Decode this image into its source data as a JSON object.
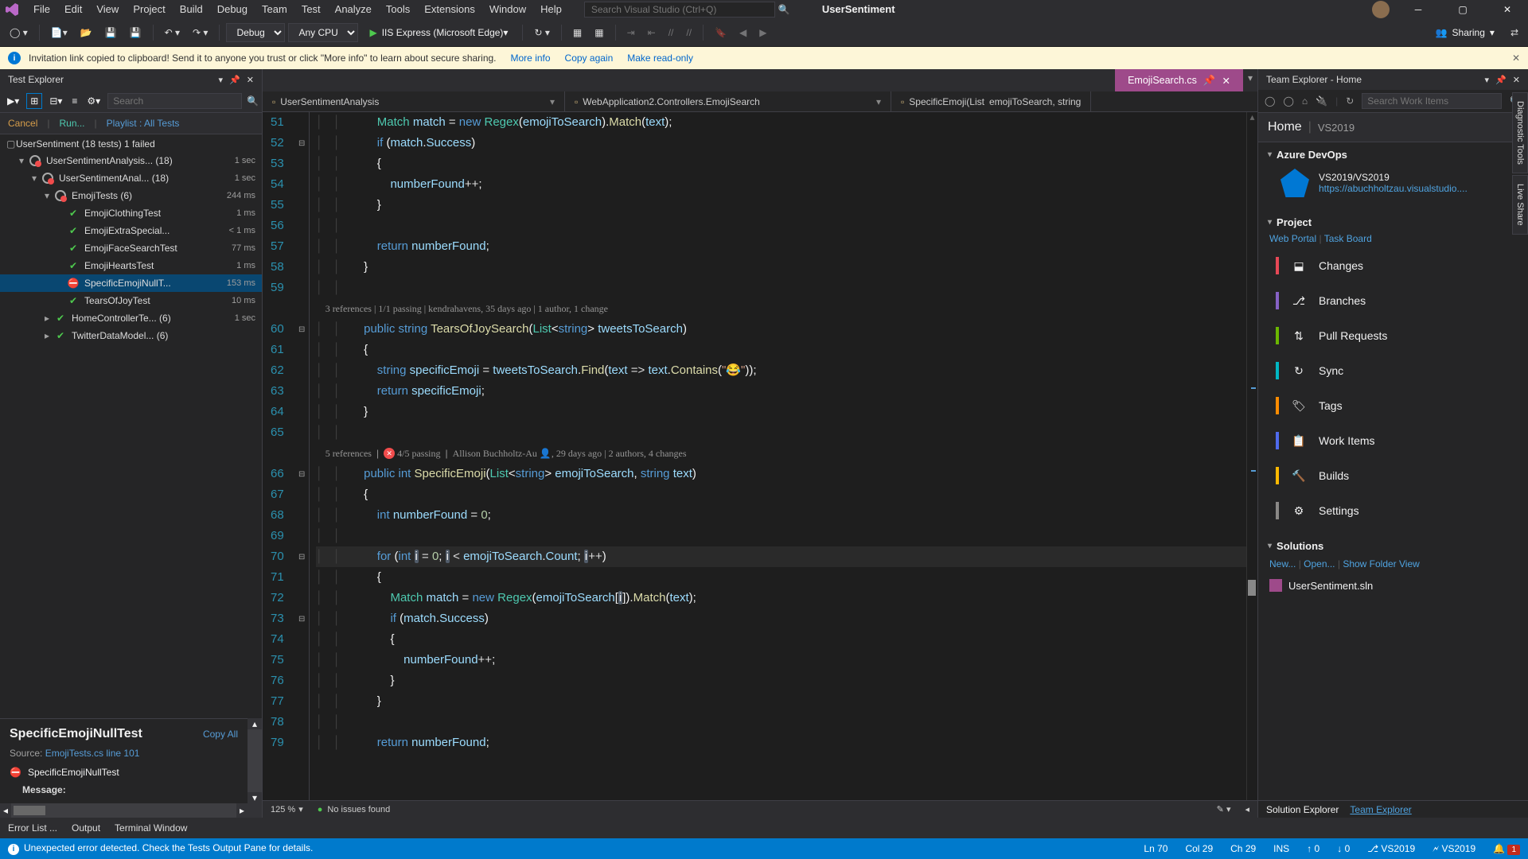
{
  "titlebar": {
    "menus": [
      "File",
      "Edit",
      "View",
      "Project",
      "Build",
      "Debug",
      "Team",
      "Test",
      "Analyze",
      "Tools",
      "Extensions",
      "Window",
      "Help"
    ],
    "search_placeholder": "Search Visual Studio (Ctrl+Q)",
    "app_name": "UserSentiment"
  },
  "toolbar": {
    "config": "Debug",
    "platform": "Any CPU",
    "run_label": "IIS Express (Microsoft Edge)",
    "sharing": "Sharing"
  },
  "infobar": {
    "message": "Invitation link copied to clipboard! Send it to anyone you trust or click \"More info\" to learn about secure sharing.",
    "more_info": "More info",
    "copy_again": "Copy again",
    "make_readonly": "Make read-only"
  },
  "test_explorer": {
    "title": "Test Explorer",
    "search_placeholder": "Search",
    "cancel": "Cancel",
    "run": "Run...",
    "playlist": "Playlist : All Tests",
    "root": {
      "name": "UserSentiment (18 tests) 1 failed",
      "dur": ""
    },
    "nodes": [
      {
        "depth": 1,
        "name": "UserSentimentAnalysis... (18)",
        "dur": "1 sec",
        "icon": "gauge-fail",
        "expanded": true
      },
      {
        "depth": 2,
        "name": "UserSentimentAnal... (18)",
        "dur": "1 sec",
        "icon": "gauge-fail",
        "expanded": true
      },
      {
        "depth": 3,
        "name": "EmojiTests (6)",
        "dur": "244 ms",
        "icon": "gauge-fail",
        "expanded": true
      },
      {
        "depth": 4,
        "name": "EmojiClothingTest",
        "dur": "1 ms",
        "icon": "pass"
      },
      {
        "depth": 4,
        "name": "EmojiExtraSpecial...",
        "dur": "< 1 ms",
        "icon": "pass"
      },
      {
        "depth": 4,
        "name": "EmojiFaceSearchTest",
        "dur": "77 ms",
        "icon": "pass"
      },
      {
        "depth": 4,
        "name": "EmojiHeartsTest",
        "dur": "1 ms",
        "icon": "pass"
      },
      {
        "depth": 4,
        "name": "SpecificEmojiNullT...",
        "dur": "153 ms",
        "icon": "fail",
        "selected": true
      },
      {
        "depth": 4,
        "name": "TearsOfJoyTest",
        "dur": "10 ms",
        "icon": "pass"
      },
      {
        "depth": 3,
        "name": "HomeControllerTe... (6)",
        "dur": "1 sec",
        "icon": "pass",
        "expandable": true
      },
      {
        "depth": 3,
        "name": "TwitterDataModel... (6)",
        "dur": "",
        "icon": "pass",
        "expandable": true
      }
    ],
    "detail": {
      "title": "SpecificEmojiNullTest",
      "copy_all": "Copy All",
      "source_label": "Source:",
      "source_link": "EmojiTests.cs line 101",
      "fail_name": "SpecificEmojiNullTest",
      "message_label": "Message:"
    }
  },
  "editor": {
    "tab": {
      "name": "EmojiSearch.cs"
    },
    "crumbs": [
      {
        "icon": "proj",
        "text": "UserSentimentAnalysis"
      },
      {
        "icon": "class",
        "text": "WebApplication2.Controllers.EmojiSearch"
      },
      {
        "icon": "method",
        "text": "SpecificEmoji(List<string> emojiToSearch, string"
      }
    ],
    "first_line": 51,
    "codelens1": "3 references | 1/1 passing | kendrahavens, 35 days ago | 1 author, 1 change",
    "codelens2_a": "5 references",
    "codelens2_b": "4/5 passing",
    "codelens2_c": "Allison Buchholtz-Au",
    "codelens2_d": ", 29 days ago | 2 authors, 4 changes",
    "status": {
      "zoom": "125 %",
      "issues": "No issues found"
    }
  },
  "team_explorer": {
    "title": "Team Explorer - Home",
    "search_placeholder": "Search Work Items",
    "home_label": "Home",
    "home_sub": "VS2019",
    "azure_head": "Azure DevOps",
    "azure_proj": "VS2019/VS2019",
    "azure_url": "https://abuchholtzau.visualstudio....",
    "project_head": "Project",
    "web_portal": "Web Portal",
    "task_board": "Task Board",
    "items": [
      {
        "label": "Changes",
        "bar": "pi-red"
      },
      {
        "label": "Branches",
        "bar": "pi-pur"
      },
      {
        "label": "Pull Requests",
        "bar": "pi-grn"
      },
      {
        "label": "Sync",
        "bar": "pi-teal"
      },
      {
        "label": "Tags",
        "bar": "pi-ora"
      },
      {
        "label": "Work Items",
        "bar": "pi-blue"
      },
      {
        "label": "Builds",
        "bar": "pi-yel"
      },
      {
        "label": "Settings",
        "bar": "pi-gray"
      }
    ],
    "solutions_head": "Solutions",
    "sol_new": "New...",
    "sol_open": "Open...",
    "sol_folder": "Show Folder View",
    "sln_name": "UserSentiment.sln",
    "footer_sol": "Solution Explorer",
    "footer_team": "Team Explorer"
  },
  "bottom_tabs": [
    "Error List ...",
    "Output",
    "Terminal Window"
  ],
  "status": {
    "error": "Unexpected error detected. Check the Tests Output Pane for details.",
    "line": "Ln 70",
    "col": "Col 29",
    "ch": "Ch 29",
    "ins": "INS",
    "up": "0",
    "down": "0",
    "repo": "VS2019",
    "branch": "VS2019",
    "notif": "1"
  },
  "side_tabs": [
    "Diagnostic Tools",
    "Live Share"
  ]
}
